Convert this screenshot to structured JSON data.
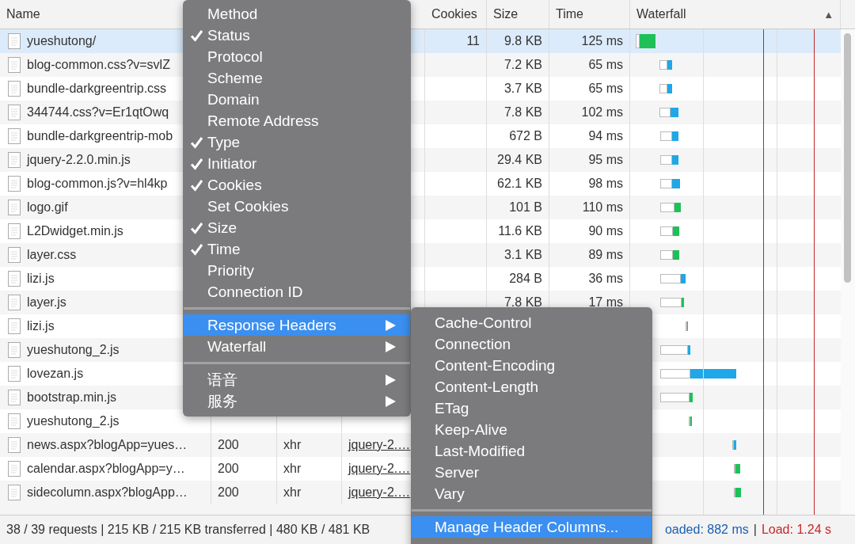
{
  "table": {
    "columns": [
      {
        "label": "Name"
      },
      {
        "label": "Cookies"
      },
      {
        "label": "Size"
      },
      {
        "label": "Time"
      },
      {
        "label": "Waterfall"
      }
    ],
    "sort_indicator": "▲",
    "rows": [
      {
        "name": "yueshutong/",
        "cookies": "11",
        "size": "9.8 KB",
        "time": "125 ms",
        "selected": true
      },
      {
        "name": "blog-common.css?v=svlZ",
        "size": "7.2 KB",
        "time": "65 ms",
        "selected": false
      },
      {
        "name": "bundle-darkgreentrip.css",
        "size": "3.7 KB",
        "time": "65 ms",
        "selected": false
      },
      {
        "name": "344744.css?v=Er1qtOwq",
        "size": "7.8 KB",
        "time": "102 ms",
        "selected": false
      },
      {
        "name": "bundle-darkgreentrip-mob",
        "size": "672 B",
        "time": "94 ms",
        "selected": false
      },
      {
        "name": "jquery-2.2.0.min.js",
        "size": "29.4 KB",
        "time": "95 ms",
        "selected": false
      },
      {
        "name": "blog-common.js?v=hl4kp",
        "size": "62.1 KB",
        "time": "98 ms",
        "selected": false
      },
      {
        "name": "logo.gif",
        "size": "101 B",
        "time": "110 ms",
        "selected": false
      },
      {
        "name": "L2Dwidget.min.js",
        "size": "11.6 KB",
        "time": "90 ms",
        "selected": false
      },
      {
        "name": "layer.css",
        "size": "3.1 KB",
        "time": "89 ms",
        "selected": false
      },
      {
        "name": "lizi.js",
        "size": "284 B",
        "time": "36 ms",
        "selected": false
      },
      {
        "name": "layer.js",
        "size": "7.8 KB",
        "time": "17 ms",
        "selected": false
      },
      {
        "name": "lizi.js",
        "selected": false
      },
      {
        "name": "yueshutong_2.js",
        "selected": false
      },
      {
        "name": "lovezan.js",
        "selected": false
      },
      {
        "name": "bootstrap.min.js",
        "selected": false
      },
      {
        "name": "yueshutong_2.js",
        "selected": false
      },
      {
        "name": "news.aspx?blogApp=yues…",
        "status": "200",
        "type": "xhr",
        "initiator": "jquery-2.…",
        "selected": false
      },
      {
        "name": "calendar.aspx?blogApp=y…",
        "status": "200",
        "type": "xhr",
        "initiator": "jquery-2.…",
        "selected": false
      },
      {
        "name": "sidecolumn.aspx?blogApp…",
        "status": "200",
        "type": "xhr",
        "initiator": "jquery-2.…",
        "selected": false
      }
    ]
  },
  "status_bar": {
    "summary": "38 / 39 requests | 215 KB / 215 KB transferred | 480 KB / 481 KB",
    "dom_loaded": "oaded: 882 ms",
    "separator": "|",
    "load": "Load: 1.24 s"
  },
  "column_menu": {
    "groups": [
      [
        {
          "kind": "check",
          "label": "Method",
          "checked": false
        },
        {
          "kind": "check",
          "label": "Status",
          "checked": true
        },
        {
          "kind": "check",
          "label": "Protocol",
          "checked": false
        },
        {
          "kind": "check",
          "label": "Scheme",
          "checked": false
        },
        {
          "kind": "check",
          "label": "Domain",
          "checked": false
        },
        {
          "kind": "check",
          "label": "Remote Address",
          "checked": false
        },
        {
          "kind": "check",
          "label": "Type",
          "checked": true
        },
        {
          "kind": "check",
          "label": "Initiator",
          "checked": true
        },
        {
          "kind": "check",
          "label": "Cookies",
          "checked": true
        },
        {
          "kind": "check",
          "label": "Set Cookies",
          "checked": false
        },
        {
          "kind": "check",
          "label": "Size",
          "checked": true
        },
        {
          "kind": "check",
          "label": "Time",
          "checked": true
        },
        {
          "kind": "check",
          "label": "Priority",
          "checked": false
        },
        {
          "kind": "check",
          "label": "Connection ID",
          "checked": false
        }
      ],
      [
        {
          "kind": "submenu",
          "label": "Response Headers",
          "selected": true
        },
        {
          "kind": "submenu",
          "label": "Waterfall",
          "selected": false
        }
      ],
      [
        {
          "kind": "submenu",
          "label": "语音",
          "selected": false
        },
        {
          "kind": "submenu",
          "label": "服务",
          "selected": false
        }
      ]
    ]
  },
  "header_submenu": {
    "groups": [
      [
        {
          "label": "Cache-Control",
          "selected": false
        },
        {
          "label": "Connection",
          "selected": false
        },
        {
          "label": "Content-Encoding",
          "selected": false
        },
        {
          "label": "Content-Length",
          "selected": false
        },
        {
          "label": "ETag",
          "selected": false
        },
        {
          "label": "Keep-Alive",
          "selected": false
        },
        {
          "label": "Last-Modified",
          "selected": false
        },
        {
          "label": "Server",
          "selected": false
        },
        {
          "label": "Vary",
          "selected": false
        }
      ],
      [
        {
          "label": "Manage Header Columns...",
          "selected": true
        }
      ]
    ]
  }
}
